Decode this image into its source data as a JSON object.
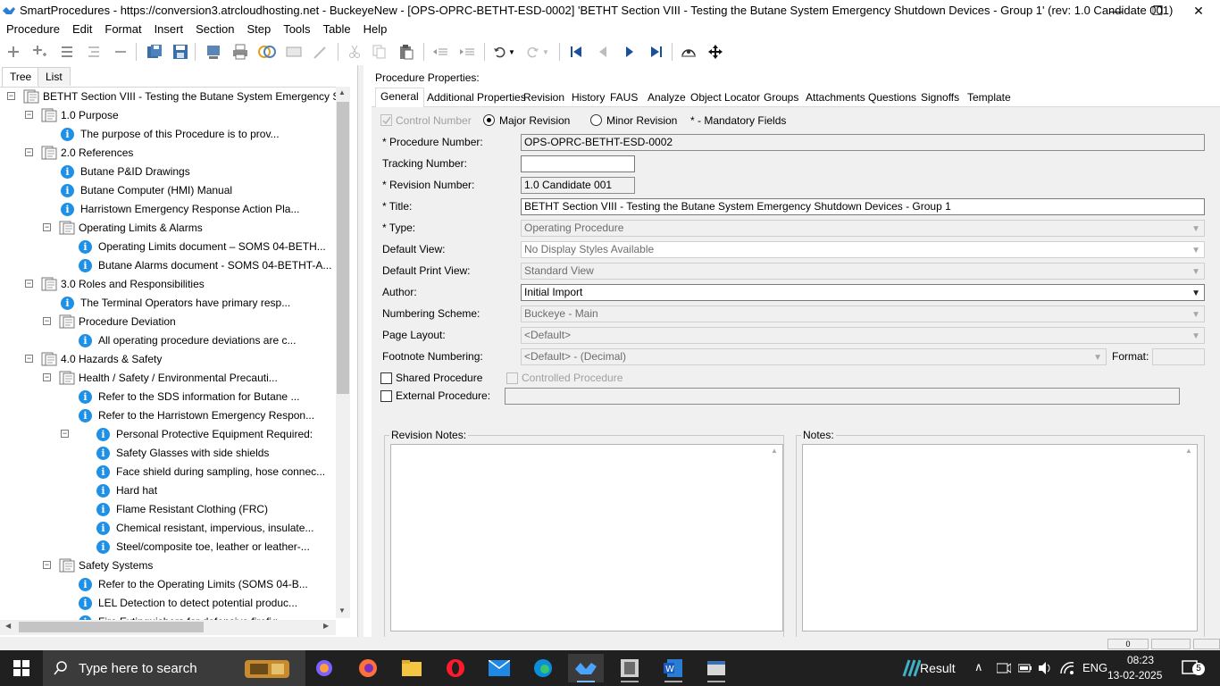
{
  "window": {
    "title": "SmartProcedures - https://conversion3.atrcloudhosting.net - BuckeyeNew - [OPS-OPRC-BETHT-ESD-0002] 'BETHT Section VIII - Testing the Butane System Emergency Shutdown Devices - Group 1' (rev: 1.0 Candidate 001)",
    "minimize": "—",
    "restore": "❐",
    "close": "✕"
  },
  "menu": [
    "Procedure",
    "Edit",
    "Format",
    "Insert",
    "Section",
    "Step",
    "Tools",
    "Table",
    "Help"
  ],
  "left_tabs": {
    "tree": "Tree",
    "list": "List"
  },
  "tree": [
    {
      "label": "BETHT Section VIII - Testing the Butane System Emergency S...",
      "type": "doc",
      "level": 0,
      "toggle": "−"
    },
    {
      "label": "1.0 Purpose",
      "type": "doc",
      "level": 1,
      "toggle": "−"
    },
    {
      "label": "The purpose of this Procedure is to prov...",
      "type": "info",
      "level": 2
    },
    {
      "label": "2.0 References",
      "type": "doc",
      "level": 1,
      "toggle": "−"
    },
    {
      "label": "Butane P&ID Drawings",
      "type": "info",
      "level": 2
    },
    {
      "label": "Butane Computer (HMI) Manual",
      "type": "info",
      "level": 2
    },
    {
      "label": "Harristown Emergency Response Action Pla...",
      "type": "info",
      "level": 2
    },
    {
      "label": "Operating Limits & Alarms",
      "type": "doc",
      "level": 2,
      "toggle": "−"
    },
    {
      "label": "Operating Limits document – SOMS 04-BETH...",
      "type": "info",
      "level": 3
    },
    {
      "label": "Butane Alarms document - SOMS 04-BETHT-A...",
      "type": "info",
      "level": 3
    },
    {
      "label": "3.0 Roles and Responsibilities",
      "type": "doc",
      "level": 1,
      "toggle": "−"
    },
    {
      "label": "The Terminal Operators have primary resp...",
      "type": "info",
      "level": 2
    },
    {
      "label": "Procedure Deviation",
      "type": "doc",
      "level": 2,
      "toggle": "−"
    },
    {
      "label": "All operating procedure deviations are c...",
      "type": "info",
      "level": 3
    },
    {
      "label": "4.0 Hazards & Safety",
      "type": "doc",
      "level": 1,
      "toggle": "−"
    },
    {
      "label": "Health / Safety / Environmental Precauti...",
      "type": "doc",
      "level": 2,
      "toggle": "−"
    },
    {
      "label": "Refer to the SDS information for Butane ...",
      "type": "info",
      "level": 3
    },
    {
      "label": "Refer to the Harristown Emergency Respon...",
      "type": "info",
      "level": 3
    },
    {
      "label": "Personal Protective Equipment Required:",
      "type": "info",
      "level": 3,
      "toggle": "−"
    },
    {
      "label": "Safety Glasses with side shields",
      "type": "info",
      "level": 4
    },
    {
      "label": "Face shield during sampling, hose connec...",
      "type": "info",
      "level": 4
    },
    {
      "label": "Hard hat",
      "type": "info",
      "level": 4
    },
    {
      "label": "Flame Resistant Clothing (FRC)",
      "type": "info",
      "level": 4
    },
    {
      "label": "Chemical resistant, impervious, insulate...",
      "type": "info",
      "level": 4
    },
    {
      "label": "Steel/composite toe, leather or leather-...",
      "type": "info",
      "level": 4
    },
    {
      "label": "Safety Systems",
      "type": "doc",
      "level": 2,
      "toggle": "−"
    },
    {
      "label": "Refer to the Operating Limits (SOMS 04-B...",
      "type": "info",
      "level": 3
    },
    {
      "label": "LEL Detection to detect potential produc...",
      "type": "info",
      "level": 3
    },
    {
      "label": "Fire Extinguishers for defensive firefig...",
      "type": "info",
      "level": 3
    }
  ],
  "props": {
    "heading": "Procedure Properties:",
    "tabs": [
      "General",
      "Additional Properties",
      "Revision",
      "History",
      "FAUS",
      "Analyze",
      "Object Locator",
      "Groups",
      "Attachments",
      "Questions",
      "Signoffs",
      "Template"
    ],
    "control_number": "Control Number",
    "major_revision": "Major Revision",
    "minor_revision": "Minor Revision",
    "mandatory_note": "* - Mandatory Fields",
    "procedure_number_label": "* Procedure Number:",
    "procedure_number": "OPS-OPRC-BETHT-ESD-0002",
    "tracking_number_label": "Tracking Number:",
    "tracking_number": "",
    "revision_number_label": "* Revision Number:",
    "revision_number": "1.0 Candidate 001",
    "title_label": "* Title:",
    "title": "BETHT Section VIII - Testing the Butane System Emergency Shutdown Devices - Group 1",
    "type_label": "* Type:",
    "type": "Operating Procedure",
    "default_view_label": "Default View:",
    "default_view": "No Display Styles Available",
    "default_print_view_label": "Default Print View:",
    "default_print_view": "Standard View",
    "author_label": "Author:",
    "author": "Initial Import",
    "numbering_label": "Numbering Scheme:",
    "numbering": "Buckeye - Main",
    "page_layout_label": "Page Layout:",
    "page_layout": "<Default>",
    "footnote_label": "Footnote Numbering:",
    "footnote": "<Default> - (Decimal)",
    "format_label": "Format:",
    "format": "",
    "shared_label": "Shared Procedure",
    "controlled_label": "Controlled Procedure",
    "external_label": "External Procedure:",
    "external": "",
    "revision_notes_label": "Revision Notes:",
    "notes_label": "Notes:"
  },
  "status": {
    "page": "0"
  },
  "taskbar": {
    "search_placeholder": "Type here to search",
    "weather": "Result",
    "lang": "ENG",
    "time": "08:23",
    "date": "13-02-2025",
    "notifications": "5"
  }
}
